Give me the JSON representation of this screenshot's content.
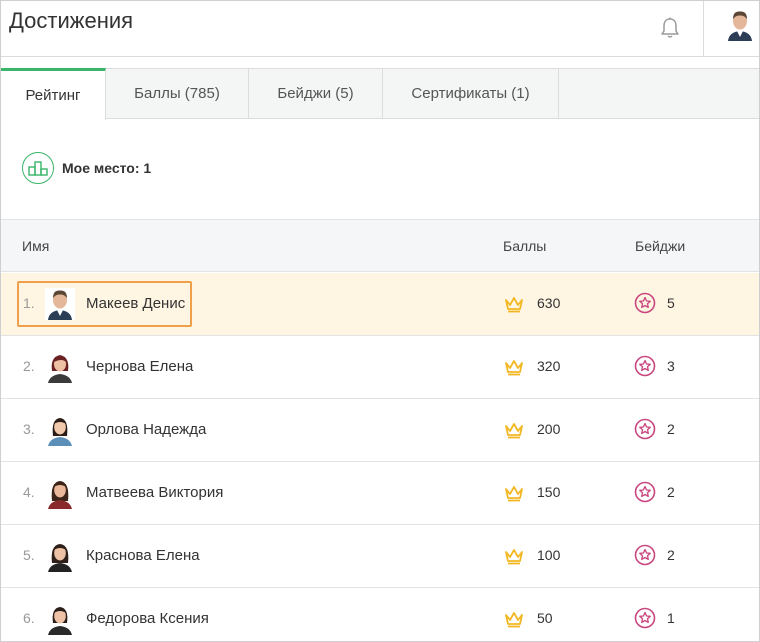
{
  "header": {
    "title": "Достижения",
    "bell_icon": "bell-icon",
    "avatar": "user-avatar"
  },
  "tabs": [
    {
      "label": "Рейтинг",
      "active": true
    },
    {
      "label": "Баллы (785)",
      "active": false
    },
    {
      "label": "Бейджи (5)",
      "active": false
    },
    {
      "label": "Сертификаты (1)",
      "active": false
    }
  ],
  "my_place": {
    "icon": "podium-icon",
    "label": "Мое место: 1"
  },
  "table": {
    "headers": {
      "name": "Имя",
      "points": "Баллы",
      "badges": "Бейджи"
    },
    "rows": [
      {
        "rank": "1.",
        "name": "Макеев Денис",
        "points": "630",
        "badges": "5",
        "highlight": true
      },
      {
        "rank": "2.",
        "name": "Чернова Елена",
        "points": "320",
        "badges": "3"
      },
      {
        "rank": "3.",
        "name": "Орлова Надежда",
        "points": "200",
        "badges": "2"
      },
      {
        "rank": "4.",
        "name": "Матвеева Виктория",
        "points": "150",
        "badges": "2"
      },
      {
        "rank": "5.",
        "name": "Краснова Елена",
        "points": "100",
        "badges": "2"
      },
      {
        "rank": "6.",
        "name": "Федорова Ксения",
        "points": "50",
        "badges": "1"
      }
    ]
  },
  "colors": {
    "accent_green": "#3ab56a",
    "crown_gold": "#f2b824",
    "badge_pink": "#c8457e",
    "highlight_row": "#fff5e3",
    "highlight_border": "#f0a04b"
  }
}
